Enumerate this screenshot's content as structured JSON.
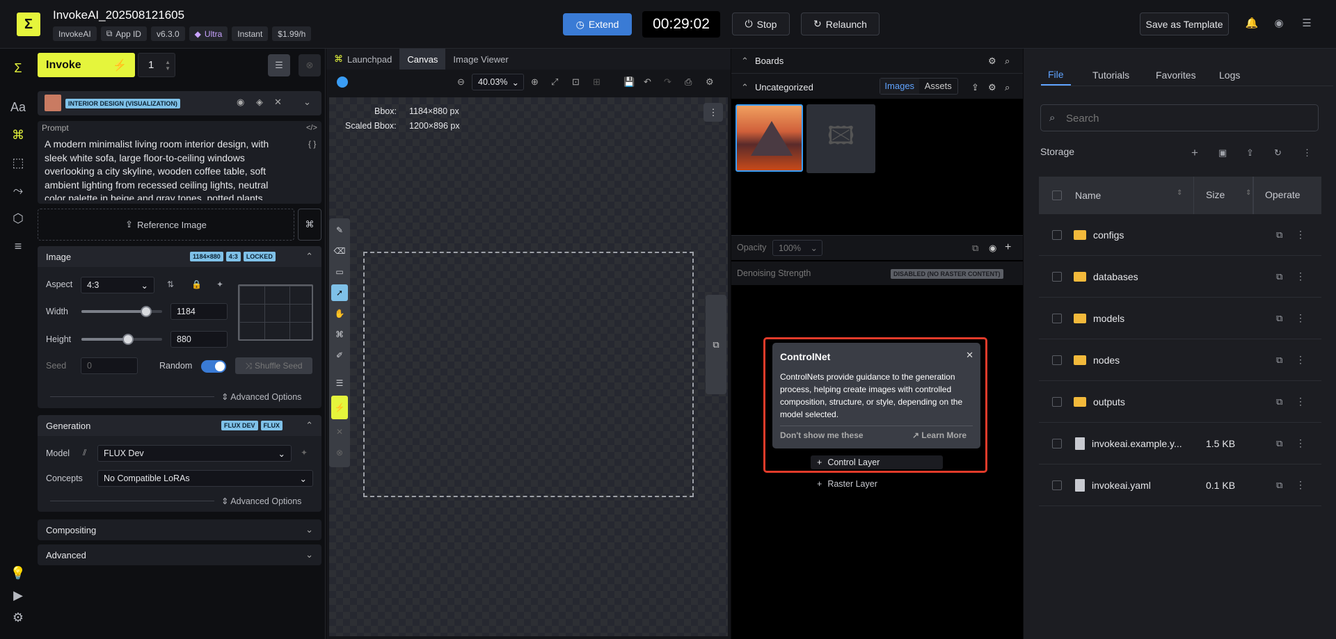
{
  "app": {
    "title": "InvokeAI_202508121605",
    "chips": [
      "InvokeAI",
      "App ID",
      "v6.3.0",
      "Ultra",
      "Instant",
      "$1.99/h"
    ]
  },
  "header": {
    "extend": "Extend",
    "timer": "00:29:02",
    "stop": "Stop",
    "relaunch": "Relaunch",
    "save_template": "Save as Template"
  },
  "params": {
    "invoke": "Invoke",
    "quantity": "1",
    "style_tag": "INTERIOR DESIGN (VISUALIZATION)",
    "prompt_label": "Prompt",
    "prompt_text": "A modern minimalist living room interior design, with sleek white sofa, large floor-to-ceiling windows overlooking a city skyline, wooden coffee table, soft ambient lighting from recessed ceiling lights, neutral color palette in beige and gray tones, potted plants",
    "reference_image": "Reference Image",
    "image": {
      "title": "Image",
      "tags": [
        "1184×880",
        "4:3",
        "LOCKED"
      ],
      "aspect_label": "Aspect",
      "aspect_value": "4:3",
      "width_label": "Width",
      "width_value": "1184",
      "width_fraction": 0.8,
      "height_label": "Height",
      "height_value": "880",
      "height_fraction": 0.58,
      "seed_label": "Seed",
      "seed_value": "0",
      "random_label": "Random",
      "shuffle": "Shuffle Seed",
      "advanced": "Advanced Options"
    },
    "generation": {
      "title": "Generation",
      "tags": [
        "FLUX DEV",
        "FLUX"
      ],
      "model_label": "Model",
      "model_value": "FLUX Dev",
      "concepts_label": "Concepts",
      "concepts_value": "No Compatible LoRAs",
      "advanced": "Advanced Options"
    },
    "compositing": "Compositing",
    "advanced": "Advanced"
  },
  "canvas": {
    "tabs": [
      "Launchpad",
      "Canvas",
      "Image Viewer"
    ],
    "zoom": "40.03%",
    "bbox_label": "Bbox:",
    "bbox_value": "1184×880 px",
    "scaled_label": "Scaled Bbox:",
    "scaled_value": "1200×896 px"
  },
  "boards": {
    "title": "Boards",
    "uncategorized": "Uncategorized",
    "tab_images": "Images",
    "tab_assets": "Assets",
    "opacity_label": "Opacity",
    "opacity_value": "100%",
    "denoise_label": "Denoising Strength",
    "denoise_badge": "DISABLED (NO RASTER CONTENT)",
    "tooltip": {
      "title": "ControlNet",
      "body": "ControlNets provide guidance to the generation process, helping create images with controlled composition, structure, or style, depending on the model selected.",
      "dont_show": "Don't show me these",
      "learn_more": "Learn More"
    },
    "add_control": "Control Layer",
    "add_raster": "Raster Layer"
  },
  "files": {
    "tabs": [
      "File",
      "Tutorials",
      "Favorites",
      "Logs"
    ],
    "search_placeholder": "Search",
    "storage": "Storage",
    "columns": {
      "name": "Name",
      "size": "Size",
      "operate": "Operate"
    },
    "rows": [
      {
        "name": "configs",
        "size": "",
        "type": "folder"
      },
      {
        "name": "databases",
        "size": "",
        "type": "folder"
      },
      {
        "name": "models",
        "size": "",
        "type": "folder"
      },
      {
        "name": "nodes",
        "size": "",
        "type": "folder"
      },
      {
        "name": "outputs",
        "size": "",
        "type": "folder"
      },
      {
        "name": "invokeai.example.y...",
        "size": "1.5 KB",
        "type": "file"
      },
      {
        "name": "invokeai.yaml",
        "size": "0.1 KB",
        "type": "file"
      }
    ]
  },
  "colors": {
    "accent_yellow": "#e5f53c",
    "accent_blue": "#3a7bd5",
    "highlight_red": "#e23b2a"
  }
}
